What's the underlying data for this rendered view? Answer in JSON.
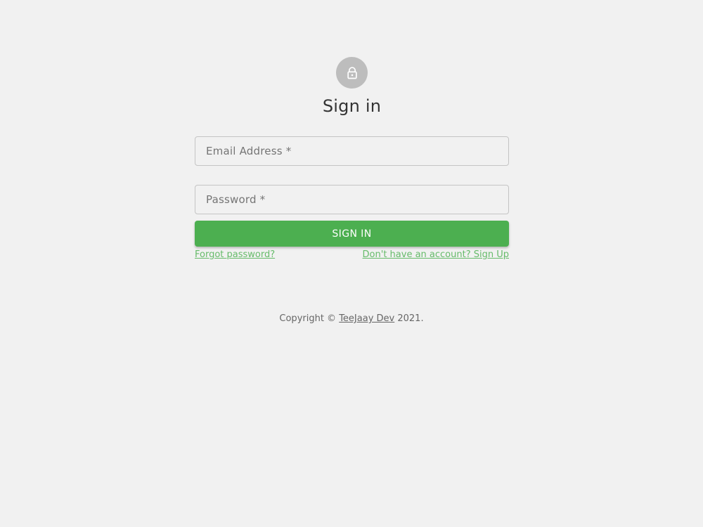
{
  "colors": {
    "background": "#f1f1f1",
    "avatar": "#bdbdbd",
    "primary": "#4caf50",
    "link": "#66bb6a"
  },
  "header": {
    "icon": "lock-icon",
    "title": "Sign in"
  },
  "form": {
    "email_label": "Email Address *",
    "password_label": "Password *",
    "submit_label": "SIGN IN"
  },
  "links": {
    "forgot": "Forgot password?",
    "signup": "Don't have an account? Sign Up"
  },
  "footer": {
    "prefix": "Copyright © ",
    "link_text": "TeeJaay Dev",
    "suffix": " 2021."
  }
}
